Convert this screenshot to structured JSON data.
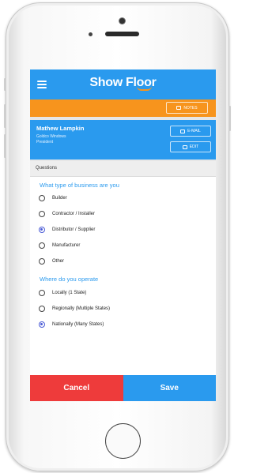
{
  "app": {
    "title_part1": "Show Fl",
    "title_o1": "o",
    "title_o2": "o",
    "title_part2": "r"
  },
  "toolbar": {
    "notes_label": "NOTES"
  },
  "contact": {
    "name": "Mathew Lampkin",
    "company": "Goldco Windows",
    "title": "President",
    "email_label": "E-MAIL",
    "edit_label": "EDIT"
  },
  "questions": {
    "header": "Questions",
    "q1": {
      "title": "What type of business are you",
      "options": [
        "Builder",
        "Contractor / Installer",
        "Distributor / Supplier",
        "Manufacturer",
        "Other"
      ],
      "selected": "Distributor / Supplier"
    },
    "q2": {
      "title": "Where do you operate",
      "options": [
        "Locally (1 State)",
        "Regionally (Multiple States)",
        "Nationally (Many States)"
      ],
      "selected": "Nationally (Many States)"
    }
  },
  "actions": {
    "cancel_label": "Cancel",
    "save_label": "Save"
  },
  "colors": {
    "primary": "#2a9aee",
    "accent": "#f7941d",
    "cancel": "#ee3b3b",
    "radio_selected": "#4a5bd6"
  },
  "icons": {
    "menu": "hamburger-icon",
    "notes": "notes-icon",
    "email": "email-icon",
    "edit": "edit-icon"
  }
}
